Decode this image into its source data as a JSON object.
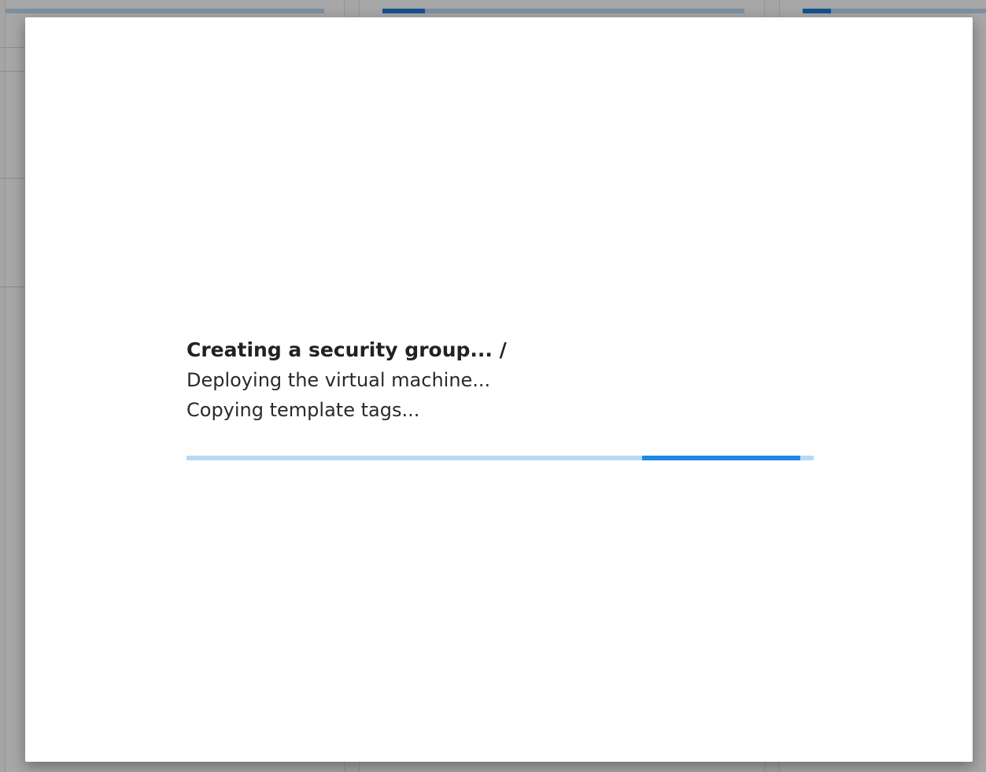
{
  "background": {
    "panels": [
      {
        "progress_fraction": 0.0
      },
      {
        "progress_fraction": 0.12
      },
      {
        "progress_fraction": 0.15
      }
    ]
  },
  "modal": {
    "title": "Creating a security group... /",
    "steps": [
      "Deploying the virtual machine...",
      "Copying template tags..."
    ],
    "progress": {
      "indeterminate": true,
      "segment_start_fraction": 0.727,
      "segment_end_fraction": 0.979,
      "track_color": "#b6daf6",
      "fill_color": "#1e88e5"
    }
  }
}
